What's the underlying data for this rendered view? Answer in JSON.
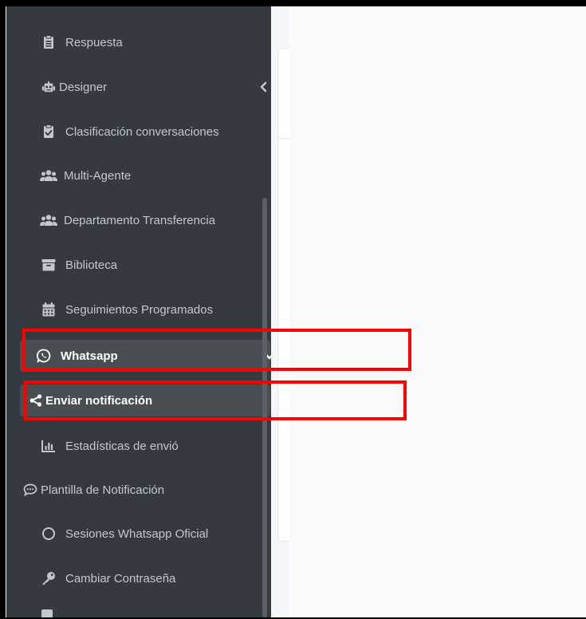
{
  "sidebar": {
    "items": [
      {
        "label": "Respuesta",
        "icon": "clipboard-list-icon"
      },
      {
        "label": "Designer",
        "icon": "robot-icon"
      },
      {
        "label": "Clasificación conversaciones",
        "icon": "clipboard-check-icon"
      },
      {
        "label": "Multi-Agente",
        "icon": "users-icon"
      },
      {
        "label": "Departamento Transferencia",
        "icon": "users-icon"
      },
      {
        "label": "Biblioteca",
        "icon": "archive-icon"
      },
      {
        "label": "Seguimientos Programados",
        "icon": "calendar-icon"
      },
      {
        "label": "Whatsapp",
        "icon": "whatsapp-icon"
      },
      {
        "label": "Enviar notificación",
        "icon": "share-icon"
      },
      {
        "label": "Estadísticas de envió",
        "icon": "chart-bar-icon"
      },
      {
        "label": "Plantilla de Notificación",
        "icon": "comment-dots-icon"
      },
      {
        "label": "Sesiones Whatsapp Oficial",
        "icon": "circle-icon"
      },
      {
        "label": "Cambiar Contraseña",
        "icon": "key-icon"
      }
    ]
  },
  "colors": {
    "sidebar_bg": "#343a40",
    "sidebar_text": "#c2c7d0",
    "active_bg": "#494e53",
    "highlight": "#ff0000"
  }
}
